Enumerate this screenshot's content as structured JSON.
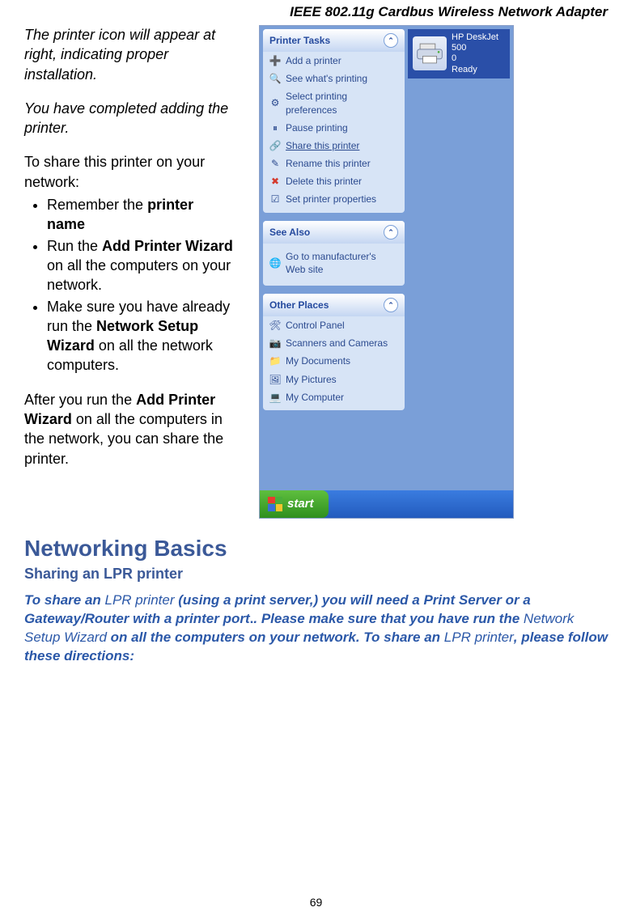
{
  "header": {
    "title": "IEEE 802.11g Cardbus Wireless Network Adapter"
  },
  "left": {
    "p1": "The printer icon will appear at right, indicating proper installation.",
    "p2": "You have completed adding the printer.",
    "p3": "To share this printer on your network:",
    "bullets": [
      {
        "prefix": "Remember the ",
        "bold": "printer name",
        "suffix": ""
      },
      {
        "prefix": "Run the ",
        "bold": "Add Printer Wizard",
        "suffix": " on all the computers on your network."
      },
      {
        "prefix": "Make sure you have already run the ",
        "bold": "Network Setup Wizard",
        "suffix": " on all the network computers."
      }
    ],
    "p4_pre": "After you run the ",
    "p4_bold": "Add Printer Wizard",
    "p4_post": " on all the computers in the network, you can share the printer."
  },
  "xp": {
    "printer": {
      "name": "HP DeskJet 500",
      "line2": "0",
      "status": "Ready"
    },
    "tasks": {
      "title": "Printer Tasks",
      "items": [
        {
          "icon": "➕",
          "label": "Add a printer"
        },
        {
          "icon": "🔍",
          "label": "See what's printing"
        },
        {
          "icon": "⚙",
          "label": "Select printing preferences"
        },
        {
          "icon": "⏸",
          "label": "Pause printing"
        },
        {
          "icon": "🔗",
          "label": "Share this printer",
          "underline": true
        },
        {
          "icon": "✎",
          "label": "Rename this printer"
        },
        {
          "icon": "✖",
          "label": "Delete this printer",
          "red": true
        },
        {
          "icon": "☑",
          "label": "Set printer properties"
        }
      ]
    },
    "seealso": {
      "title": "See Also",
      "items": [
        {
          "icon": "🌐",
          "label": "Go to manufacturer's Web site"
        }
      ]
    },
    "other": {
      "title": "Other Places",
      "items": [
        {
          "icon": "🛠",
          "label": "Control Panel"
        },
        {
          "icon": "📷",
          "label": "Scanners and Cameras"
        },
        {
          "icon": "📁",
          "label": "My Documents"
        },
        {
          "icon": "🖼",
          "label": "My Pictures"
        },
        {
          "icon": "💻",
          "label": "My Computer"
        }
      ]
    },
    "start": "start"
  },
  "nb": {
    "heading": "Networking Basics",
    "sub": "Sharing an LPR printer",
    "b1_pre": "To share an ",
    "b1_it1": "LPR printer",
    "b1_mid1": " (using a print server,) you will need a Print Server or a Gateway/Router with a printer port",
    "b1_mid2": ".  Please make sure that you have run the ",
    "b1_it2": "Network Setup Wizard",
    "b1_mid3": " on all the computers on your network. To share an ",
    "b1_it3": "LPR printer",
    "b1_post": ", please follow these directions:"
  },
  "page_number": "69"
}
